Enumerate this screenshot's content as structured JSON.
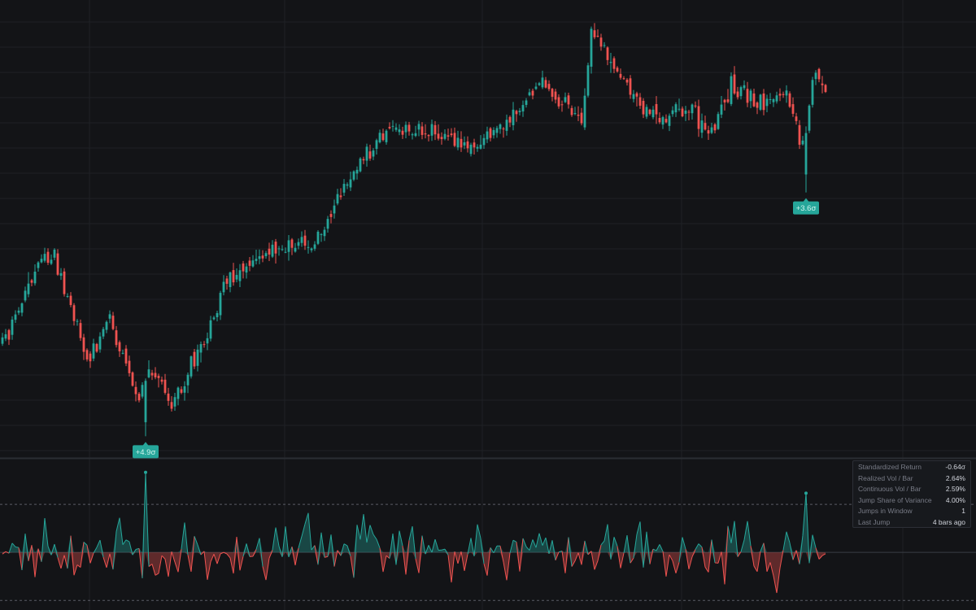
{
  "theme": {
    "background": "#131417",
    "grid": "#1f2125",
    "separator": "#2a2d33",
    "up": "#26a69a",
    "down": "#ef5350",
    "threshold_line": "#787b86",
    "badge_bg": "#26a69a",
    "badge_text": "#d1f5ee"
  },
  "chart_data": [
    {
      "type": "candlestick",
      "title": "",
      "num_bars": 254,
      "price_range": [
        37.8,
        66.5
      ],
      "waypoints": [
        {
          "bar": 0,
          "close": 45.0
        },
        {
          "bar": 11,
          "close": 49.8
        },
        {
          "bar": 16,
          "close": 50.6
        },
        {
          "bar": 26,
          "close": 44.0
        },
        {
          "bar": 33,
          "close": 46.6
        },
        {
          "bar": 42,
          "close": 41.6
        },
        {
          "bar": 46,
          "close": 43.2
        },
        {
          "bar": 52,
          "close": 41.2
        },
        {
          "bar": 62,
          "close": 45.2
        },
        {
          "bar": 68,
          "close": 48.6
        },
        {
          "bar": 78,
          "close": 50.2
        },
        {
          "bar": 96,
          "close": 51.4
        },
        {
          "bar": 110,
          "close": 56.4
        },
        {
          "bar": 120,
          "close": 58.6
        },
        {
          "bar": 132,
          "close": 58.4
        },
        {
          "bar": 142,
          "close": 57.0
        },
        {
          "bar": 154,
          "close": 58.8
        },
        {
          "bar": 166,
          "close": 61.2
        },
        {
          "bar": 178,
          "close": 59.0
        },
        {
          "bar": 181,
          "close": 64.8
        },
        {
          "bar": 190,
          "close": 61.4
        },
        {
          "bar": 200,
          "close": 59.2
        },
        {
          "bar": 212,
          "close": 59.6
        },
        {
          "bar": 218,
          "close": 58.0
        },
        {
          "bar": 224,
          "close": 61.2
        },
        {
          "bar": 234,
          "close": 59.8
        },
        {
          "bar": 240,
          "close": 61.0
        },
        {
          "bar": 246,
          "close": 57.6
        },
        {
          "bar": 249,
          "close": 61.4
        },
        {
          "bar": 253,
          "close": 61.3
        }
      ],
      "jump_markers": [
        {
          "bar": 44,
          "label": "+4.9σ",
          "direction": "up"
        },
        {
          "bar": 247,
          "label": "+3.6σ",
          "direction": "up"
        }
      ]
    },
    {
      "type": "line",
      "series_name": "Standardized Return",
      "y_range": [
        -3.6,
        5.8
      ],
      "threshold": 3.0,
      "spikes": [
        {
          "bar": 44,
          "value": 5.0
        },
        {
          "bar": 247,
          "value": 3.7
        }
      ]
    }
  ],
  "stats": [
    {
      "label": "Standardized Return",
      "value": "-0.64σ"
    },
    {
      "label": "Realized Vol / Bar",
      "value": "2.64%"
    },
    {
      "label": "Continuous Vol / Bar",
      "value": "2.59%"
    },
    {
      "label": "Jump Share of Variance",
      "value": "4.00%"
    },
    {
      "label": "Jumps in Window",
      "value": "1"
    },
    {
      "label": "Last Jump",
      "value": "4 bars ago"
    }
  ]
}
